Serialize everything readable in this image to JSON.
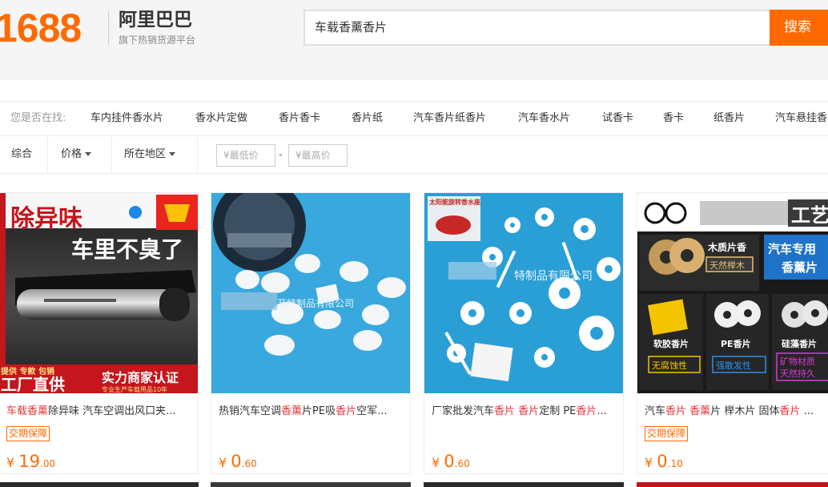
{
  "header": {
    "logo_number": "1688",
    "logo_brand": "阿里巴巴",
    "logo_tagline": "旗下热销货源平台",
    "search_value": "车载香薰香片",
    "search_button": "搜索"
  },
  "suggestions": {
    "label": "您是否在找:",
    "items": [
      "车内挂件香水片",
      "香水片定做",
      "香片香卡",
      "香片纸",
      "汽车香片纸香片",
      "汽车香水片",
      "试香卡",
      "香卡",
      "纸香片",
      "汽车悬挂香"
    ]
  },
  "filters": {
    "sort_all": "综合",
    "price": "价格",
    "region": "所在地区",
    "min_placeholder": "¥最低价",
    "dash": "-",
    "max_placeholder": "¥最高价"
  },
  "products": [
    {
      "title_parts": [
        {
          "t": "车载香薰",
          "hl": true
        },
        {
          "t": "除异味 汽车空调出风口夹...",
          "hl": false
        }
      ],
      "badge": "交期保障",
      "price_symbol": "¥",
      "price_int": "19",
      "price_dec": ".00",
      "image_text": {
        "headline": "除异味",
        "sub": "车里不臭了",
        "bottom_left_top": "提供 专款 包销",
        "bottom_left": "工厂直供",
        "bottom_right": "实力商家认证",
        "bottom_right_sub": "专业生产车载用品10年"
      }
    },
    {
      "title_parts": [
        {
          "t": "热销汽车空调",
          "hl": false
        },
        {
          "t": "香薰",
          "hl": true
        },
        {
          "t": "片PE吸",
          "hl": false
        },
        {
          "t": "香片",
          "hl": true
        },
        {
          "t": "空军...",
          "hl": false
        }
      ],
      "badge": "",
      "price_symbol": "¥",
      "price_int": "0",
      "price_dec": ".60",
      "image_text": {
        "watermark": "菲特制品有限公司"
      }
    },
    {
      "title_parts": [
        {
          "t": "厂家批发汽车",
          "hl": false
        },
        {
          "t": "香片",
          "hl": true
        },
        {
          "t": " ",
          "hl": false
        },
        {
          "t": "香片",
          "hl": true
        },
        {
          "t": "定制 PE",
          "hl": false
        },
        {
          "t": "香片",
          "hl": true
        },
        {
          "t": "...",
          "hl": false
        }
      ],
      "badge": "",
      "price_symbol": "¥",
      "price_int": "0",
      "price_dec": ".60",
      "image_text": {
        "label": "太阳能旋转香水座",
        "watermark": "特制品有限公司"
      }
    },
    {
      "title_parts": [
        {
          "t": "汽车",
          "hl": false
        },
        {
          "t": "香片",
          "hl": true
        },
        {
          "t": " ",
          "hl": false
        },
        {
          "t": "香薰",
          "hl": true
        },
        {
          "t": "片 榉木片 固体",
          "hl": false
        },
        {
          "t": "香片",
          "hl": true
        },
        {
          "t": " ...",
          "hl": false
        }
      ],
      "badge": "交期保障",
      "price_symbol": "¥",
      "price_int": "0",
      "price_dec": ".10",
      "image_text": {
        "brand": "工艺",
        "wood_label": "木质片香",
        "wood_tag": "天然榉木",
        "car_label": "汽车专用",
        "car_label2": "香薰片",
        "soft_label": "软胶香片",
        "soft_tag": "无腐蚀性",
        "pe_label": "PE香片",
        "pe_tag": "强散发性",
        "diatom_label": "硅藻香片",
        "diatom_tag": "矿物材质",
        "diatom_tag2": "天然持久"
      }
    }
  ],
  "colors": {
    "accent": "#ff6a00",
    "highlight": "#e4393c"
  }
}
